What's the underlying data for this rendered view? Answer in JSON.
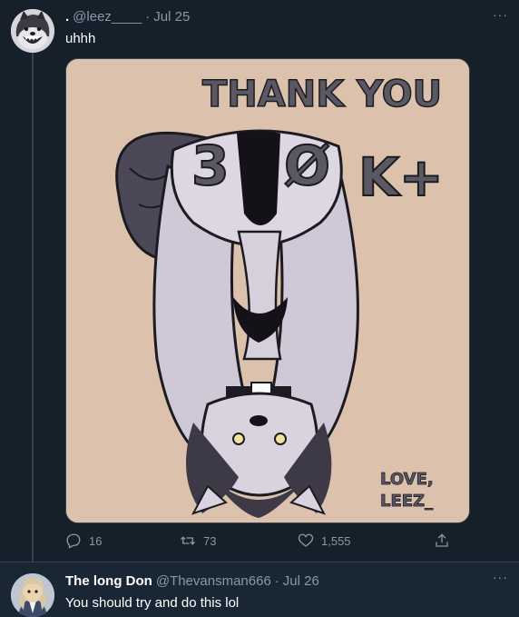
{
  "tweet1": {
    "display_name": ".",
    "handle": "@leez____",
    "separator": "·",
    "date": "Jul 25",
    "text": "uhhh",
    "more": "···",
    "media": {
      "headline": "THANK YOU",
      "count_digits": [
        "3",
        "Ø"
      ],
      "count_suffix": "K+",
      "signature_line1": "LOVE,",
      "signature_line2": "LEEZ_"
    },
    "actions": {
      "reply_count": "16",
      "retweet_count": "73",
      "like_count": "1,555"
    }
  },
  "tweet2": {
    "display_name": "The long Don",
    "handle": "@Thevansman666",
    "separator": "·",
    "date": "Jul 26",
    "text": "You should try and do this lol",
    "more": "···"
  },
  "icons": {
    "reply": "reply-icon",
    "retweet": "retweet-icon",
    "like": "heart-icon",
    "share": "share-icon",
    "more": "more-icon"
  },
  "colors": {
    "background": "#15202b",
    "reply_background": "#192734",
    "muted_text": "#8899a6",
    "divider": "#38444d",
    "media_background": "#dcc1ad"
  }
}
